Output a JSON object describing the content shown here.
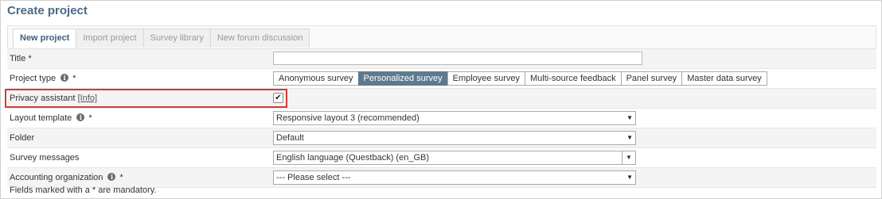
{
  "page": {
    "title": "Create project"
  },
  "tabs": [
    {
      "label": "New project",
      "active": true
    },
    {
      "label": "Import project",
      "active": false
    },
    {
      "label": "Survey library",
      "active": false
    },
    {
      "label": "New forum discussion",
      "active": false
    }
  ],
  "form": {
    "title": {
      "label": "Title *",
      "value": ""
    },
    "project_type": {
      "label": "Project type",
      "required": "*",
      "options": [
        "Anonymous survey",
        "Personalized survey",
        "Employee survey",
        "Multi-source feedback",
        "Panel survey",
        "Master data survey"
      ],
      "selected": "Personalized survey"
    },
    "privacy_assistant": {
      "label": "Privacy assistant",
      "info_link": "[Info]",
      "checked": true,
      "check_mark": "✔"
    },
    "layout_template": {
      "label": "Layout template",
      "required": "*",
      "value": "Responsive layout 3 (recommended)"
    },
    "folder": {
      "label": "Folder",
      "value": "Default"
    },
    "survey_messages": {
      "label": "Survey messages",
      "value": "English language (Questback) (en_GB)"
    },
    "accounting_organization": {
      "label": "Accounting organization",
      "required": "*",
      "value": "--- Please select ---"
    }
  },
  "icons": {
    "info": "info-icon",
    "dropdown": "chevron-down-icon",
    "arrow_glyph": "▼"
  },
  "footer": {
    "note": "Fields marked with a * are mandatory."
  },
  "colors": {
    "title": "#4a6a86",
    "active_segment": "#5f7a8e",
    "highlight_border": "#d63a3a"
  }
}
